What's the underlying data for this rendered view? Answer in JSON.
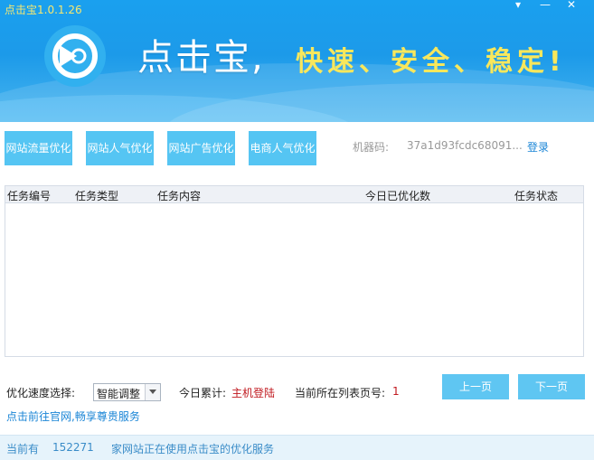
{
  "window": {
    "title": "点击宝1.0.1.26",
    "dropdown_glyph": "▾",
    "minimize_glyph": "—",
    "close_glyph": "✕"
  },
  "banner": {
    "slogan_main": "点击宝,",
    "slogan_sub": "快速、安全、稳定!",
    "logo_icon": "play-circle-icon"
  },
  "toolbar": {
    "buttons": [
      {
        "label": "网站流量优化"
      },
      {
        "label": "网站人气优化"
      },
      {
        "label": "网站广告优化"
      },
      {
        "label": "电商人气优化"
      }
    ],
    "machine_label": "机器码:",
    "machine_code": "37a1d93fcdc68091...",
    "login": "登录"
  },
  "table": {
    "columns": [
      "任务编号",
      "任务类型",
      "任务内容",
      "今日已优化数",
      "任务状态"
    ],
    "rows": []
  },
  "controls": {
    "speed_label": "优化速度选择:",
    "speed_value": "智能调整",
    "today_label": "今日累计:",
    "today_value": "主机登陆",
    "page_label": "当前所在列表页号:",
    "page_value": "1",
    "prev": "上一页",
    "next": "下一页",
    "site_link": "点击前往官网,畅享尊贵服务"
  },
  "status": {
    "prefix": "当前有",
    "count": "152271",
    "suffix": "家网站正在使用点击宝的优化服务"
  },
  "colors": {
    "banner_blue": "#1c9ae9",
    "button_blue": "#55c5f3",
    "title_yellow": "#f7e870",
    "accent_red": "#c0181e",
    "link_blue": "#1a85d6"
  }
}
